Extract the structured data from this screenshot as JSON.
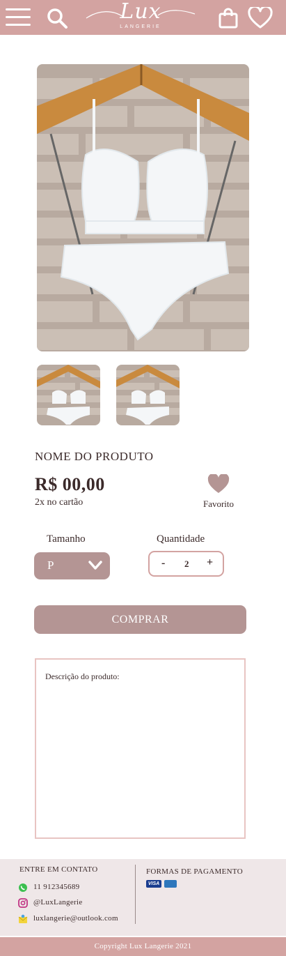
{
  "header": {
    "logo_text": "Lux",
    "logo_subtext": "LANGERIE"
  },
  "product": {
    "name": "NOME DO PRODUTO",
    "price": "R$ 00,00",
    "installments": "2x no cartão",
    "favorite_label": "Favorito",
    "size_label": "Tamanho",
    "size_value": "P",
    "quantity_label": "Quantidade",
    "quantity_minus": "-",
    "quantity_value": "2",
    "quantity_plus": "+",
    "buy_label": "COMPRAR",
    "description_label": "Descrição do produto:"
  },
  "footer": {
    "contact_title": "ENTRE EM CONTATO",
    "contacts": [
      {
        "icon": "whatsapp-icon",
        "text": "11 912345689"
      },
      {
        "icon": "instagram-icon",
        "text": "@LuxLangerie"
      },
      {
        "icon": "email-icon",
        "text": "luxlangerie@outlook.com"
      }
    ],
    "payment_title": "FORMAS DE PAGAMENTO",
    "payment_methods": [
      {
        "icon": "visa-icon",
        "text": "VISA"
      },
      {
        "icon": "amex-icon",
        "text": ""
      }
    ],
    "copyright": "Copyright Lux Langerie 2021"
  },
  "colors": {
    "brand_pink": "#d3a3a1",
    "button_mauve": "#b49594",
    "footer_bg": "#efe7e8",
    "text_dark": "#3b2a2a"
  }
}
